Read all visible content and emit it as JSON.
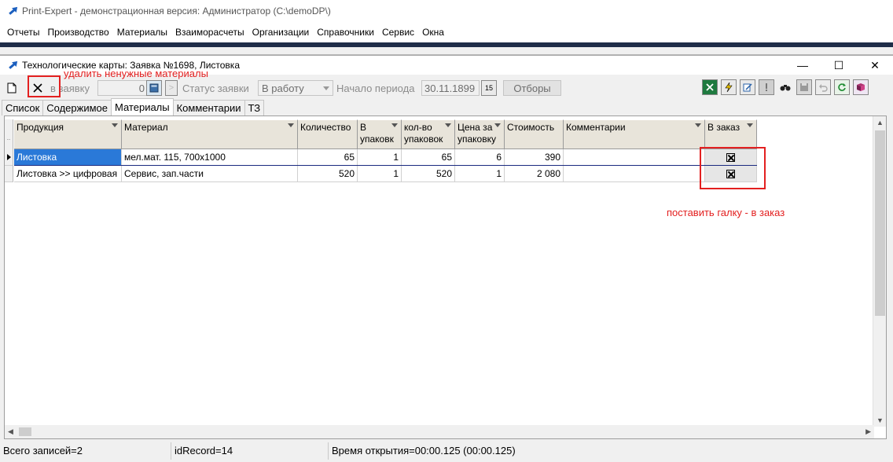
{
  "app": {
    "title": "Print-Expert - демонстрационная версия: Администратор (C:\\demoDP\\)",
    "menu": [
      "Отчеты",
      "Производство",
      "Материалы",
      "Взаиморасчеты",
      "Организации",
      "Справочники",
      "Сервис",
      "Окна"
    ]
  },
  "window": {
    "title": "Технологические карты: Заявка №1698, Листовка",
    "minimize": "—",
    "maximize": "☐",
    "close": "✕"
  },
  "toolbar": {
    "new_icon": "new-document-icon",
    "delete_icon": "cross-delete-icon",
    "to_order_label": "в заявку",
    "quantity_value": "0",
    "calculator_icon": "calculator-icon",
    "go_arrow": ">",
    "status_label": "Статус заявки",
    "status_value": "В работу",
    "period_label": "Начало периода",
    "period_date": "30.11.1899",
    "calendar_label": "15",
    "filter_button": "Отборы",
    "right_icons": [
      "excel-icon",
      "lightning-icon",
      "edit-note-icon",
      "exclamation-icon",
      "binoculars-icon",
      "save-disk-icon",
      "undo-icon",
      "refresh-icon",
      "book-icon"
    ]
  },
  "tabs": [
    {
      "label": "Список",
      "active": false
    },
    {
      "label": "Содержимое",
      "active": false
    },
    {
      "label": "Материалы",
      "active": true
    },
    {
      "label": "Комментарии",
      "active": false
    },
    {
      "label": "ТЗ",
      "active": false
    }
  ],
  "grid": {
    "headers": [
      "Продукция",
      "Материал",
      "Количество",
      "В упаковк",
      "кол-во упаковок",
      "Цена за упаковку",
      "Стоимость",
      "Комментарии",
      "В заказ"
    ],
    "rows": [
      {
        "product": "Листовка",
        "material": "мел.мат. 115, 700x1000",
        "qty": "65",
        "pack": "1",
        "packs": "65",
        "price": "6",
        "cost": "390",
        "comment": "",
        "in_order": true
      },
      {
        "product": "Листовка >> цифровая",
        "material": "Сервис, зап.части",
        "qty": "520",
        "pack": "1",
        "packs": "520",
        "price": "1",
        "cost": "2 080",
        "comment": "",
        "in_order": true
      }
    ]
  },
  "status": {
    "records": "Всего записей=2",
    "id_record": "idRecord=14",
    "open_time": "Время открытия=00:00.125 (00:00.125)"
  },
  "annotations": {
    "delete_note": "удалить ненужные материалы",
    "checkbox_note": "поставить галку - в заказ",
    "color": "#e32020"
  }
}
